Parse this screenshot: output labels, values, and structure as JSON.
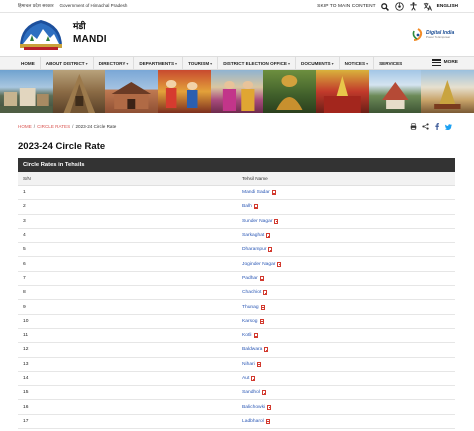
{
  "topbar": {
    "gov_hindi": "हिमाचल प्रदेश सरकार",
    "gov_english": "Government of Himachal Pradesh",
    "skip_label": "SKIP TO MAIN CONTENT",
    "language_label": "ENGLISH",
    "icons": [
      "search-icon",
      "sitemap-icon",
      "accessibility-icon",
      "language-icon"
    ]
  },
  "header": {
    "title_hindi": "मंडी",
    "title": "MANDI",
    "digital_india": "Digital India",
    "digital_india_tagline": "Power To Empower"
  },
  "nav": {
    "items": [
      {
        "label": "HOME",
        "dropdown": false
      },
      {
        "label": "ABOUT DISTRICT",
        "dropdown": true
      },
      {
        "label": "DIRECTORY",
        "dropdown": true
      },
      {
        "label": "DEPARTMENTS",
        "dropdown": true
      },
      {
        "label": "TOURISM",
        "dropdown": true
      },
      {
        "label": "DISTRICT ELECTION OFFICE",
        "dropdown": true
      },
      {
        "label": "DOCUMENTS",
        "dropdown": true
      },
      {
        "label": "NOTICES",
        "dropdown": true
      },
      {
        "label": "SERVICES",
        "dropdown": false
      }
    ],
    "more_label": "MORE"
  },
  "breadcrumb": {
    "home": "HOME",
    "section": "CIRCLE RATES",
    "current": "2023-24 Circle Rate",
    "separator": "/"
  },
  "page_title": "2023-24 Circle Rate",
  "table": {
    "caption": "Circle Rates in Tehsils",
    "columns": [
      "S/N",
      "Tehsil Name"
    ],
    "rows": [
      {
        "sn": "1",
        "name": "Mandi Sadar"
      },
      {
        "sn": "2",
        "name": "Balh"
      },
      {
        "sn": "3",
        "name": "Sunder Nagar"
      },
      {
        "sn": "4",
        "name": "Sarkaghat"
      },
      {
        "sn": "5",
        "name": "Dharampur"
      },
      {
        "sn": "6",
        "name": "Joginder Nagar"
      },
      {
        "sn": "7",
        "name": "Padhar"
      },
      {
        "sn": "8",
        "name": "Chachiot"
      },
      {
        "sn": "9",
        "name": "Thunag"
      },
      {
        "sn": "10",
        "name": "Karsog"
      },
      {
        "sn": "11",
        "name": "Kotli"
      },
      {
        "sn": "12",
        "name": "Baldwara"
      },
      {
        "sn": "13",
        "name": "Nihari"
      },
      {
        "sn": "14",
        "name": "Aut"
      },
      {
        "sn": "15",
        "name": "Sandhol"
      },
      {
        "sn": "16",
        "name": "Balichowki"
      },
      {
        "sn": "17",
        "name": "Ladbharol"
      }
    ]
  },
  "colors": {
    "caption_bg": "#333333",
    "link": "#2b58b5",
    "breadcrumb_link": "#d9534f",
    "pdf_icon": "#d23a2f"
  }
}
